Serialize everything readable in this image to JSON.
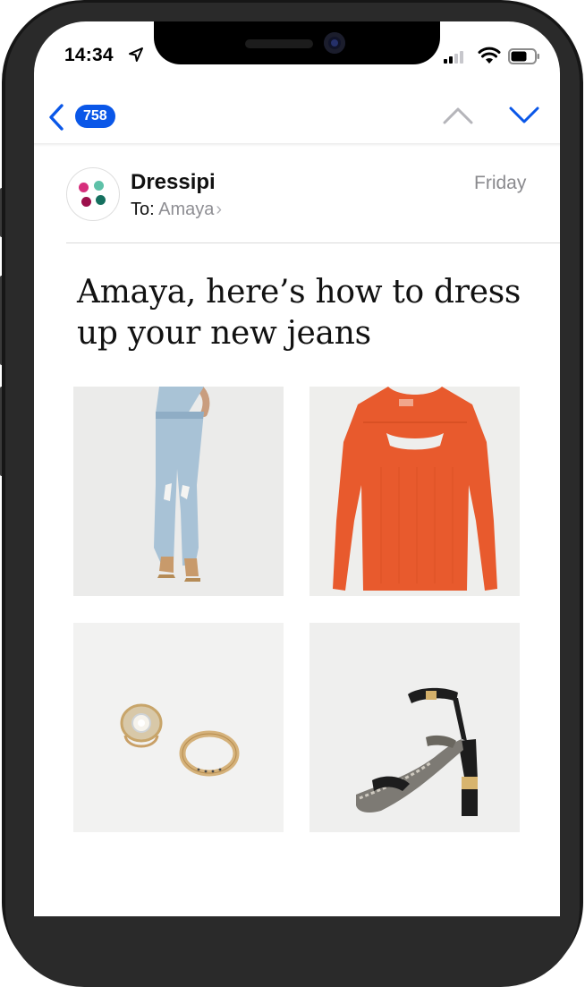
{
  "status_bar": {
    "time": "14:34"
  },
  "nav": {
    "unread_count": "758"
  },
  "email": {
    "sender": "Dressipi",
    "to_label": "To:",
    "recipient": "Amaya",
    "date": "Friday",
    "headline": "Amaya, here’s how to dress up your new jeans",
    "products": [
      {
        "image": "light-blue-ripped-flared-jeans"
      },
      {
        "image": "orange-cutout-long-sleeve-top"
      },
      {
        "image": "gold-crystal-rings"
      },
      {
        "image": "snake-print-heeled-sandal"
      }
    ]
  },
  "colors": {
    "accent": "#0a57e8",
    "logo_dots": [
      "#d62f7c",
      "#5ec1a8",
      "#9c0f4b",
      "#15705f"
    ]
  },
  "icons": [
    "location-arrow-icon",
    "signal-icon",
    "wifi-icon",
    "battery-icon",
    "back-chevron-icon",
    "previous-message-icon",
    "next-message-icon"
  ]
}
